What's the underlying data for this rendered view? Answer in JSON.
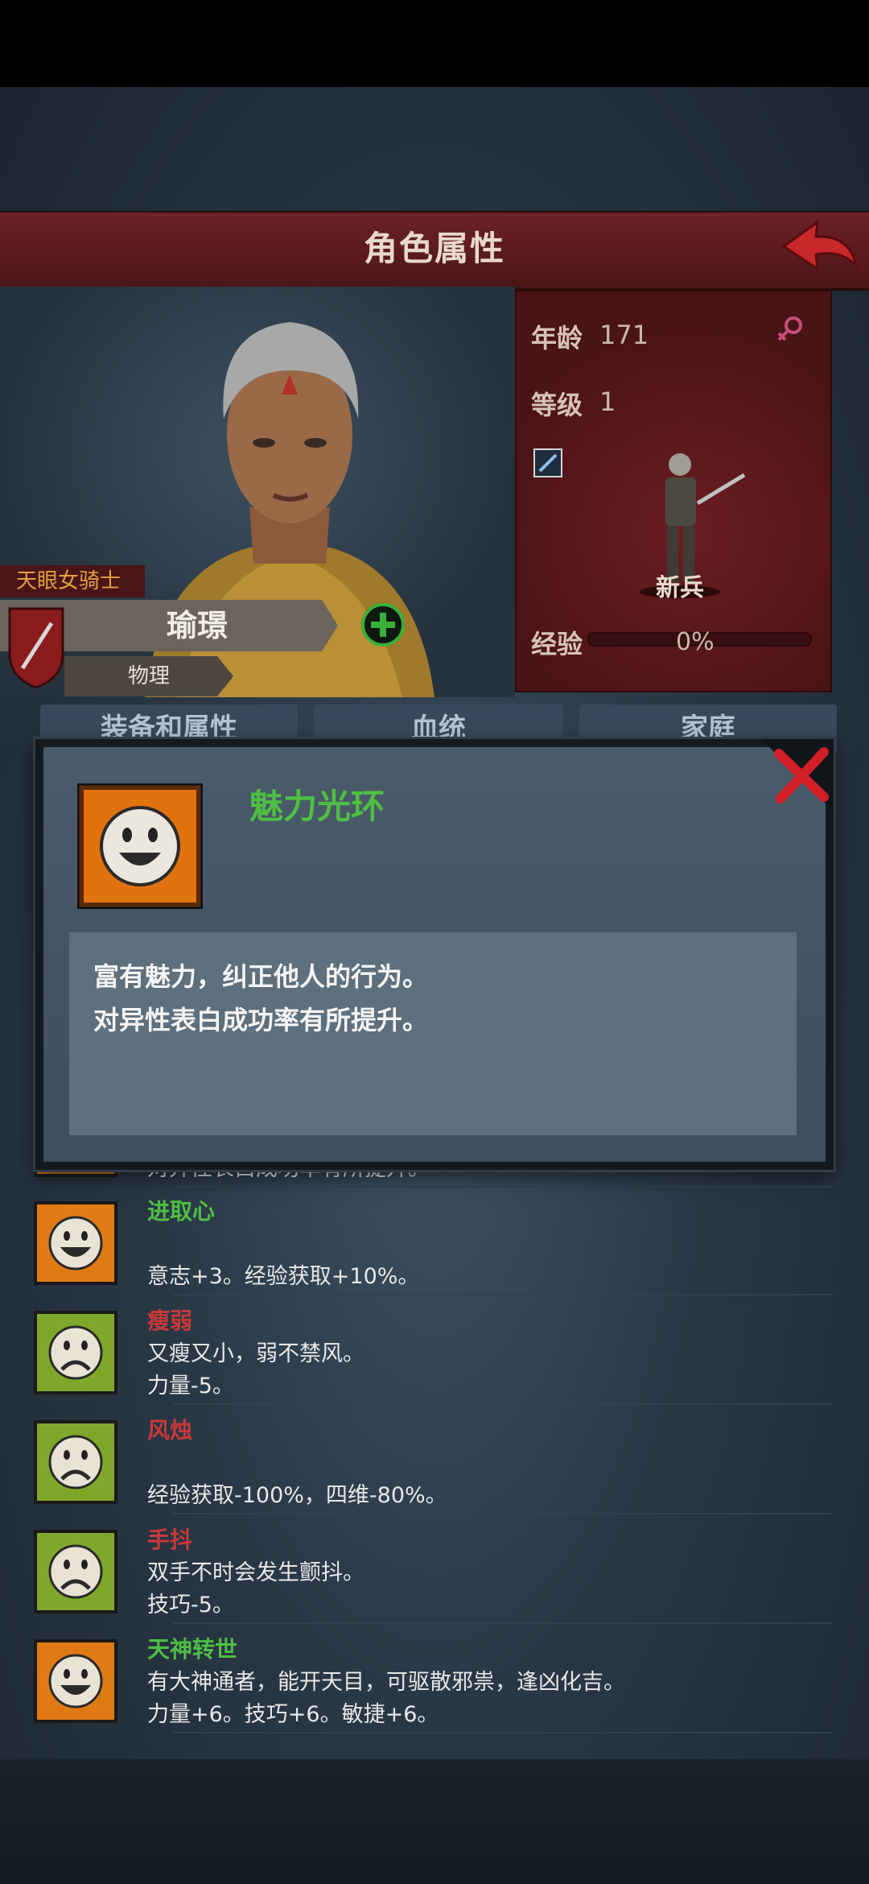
{
  "header": {
    "title": "角色属性"
  },
  "character": {
    "title": "天眼女骑士",
    "name": "瑜璟",
    "damage_type": "物理"
  },
  "stats": {
    "age_label": "年龄",
    "age_value": "171",
    "level_label": "等级",
    "level_value": "1",
    "class_name": "新兵",
    "exp_label": "经验",
    "exp_value": "0%"
  },
  "tabs": [
    {
      "label": "装备和属性"
    },
    {
      "label": "血统"
    },
    {
      "label": "家庭"
    }
  ],
  "popup": {
    "title": "魅力光环",
    "lines": [
      "富有魅力，纠正他人的行为。",
      "对异性表白成功率有所提升。"
    ]
  },
  "traits": [
    {
      "title": "",
      "lines": [
        "对异性表白成功率有所提升。"
      ],
      "mood": "happy"
    },
    {
      "title": "进取心",
      "lines": [
        "",
        "意志+3。经验获取+10%。"
      ],
      "mood": "happy"
    },
    {
      "title": "瘦弱",
      "lines": [
        "又瘦又小，弱不禁风。",
        "力量-5。"
      ],
      "mood": "sad"
    },
    {
      "title": "风烛",
      "lines": [
        "",
        "经验获取-100%，四维-80%。"
      ],
      "mood": "sad"
    },
    {
      "title": "手抖",
      "lines": [
        "双手不时会发生颤抖。",
        "技巧-5。"
      ],
      "mood": "sad"
    },
    {
      "title": "天神转世",
      "lines": [
        "有大神通者，能开天目，可驱散邪祟，逢凶化吉。",
        "力量+6。技巧+6。敏捷+6。"
      ],
      "mood": "happy"
    }
  ],
  "colors": {
    "positive_title": "#4fbf43",
    "negative_title": "#c8393a",
    "header_red": "#6e2226",
    "happy_icon": "#e07a14",
    "sad_icon": "#7fa82a"
  },
  "icons": {
    "back": "back-arrow-icon",
    "female": "female-icon",
    "weapon": "sword-icon",
    "add": "plus-icon",
    "close": "close-x-icon"
  }
}
